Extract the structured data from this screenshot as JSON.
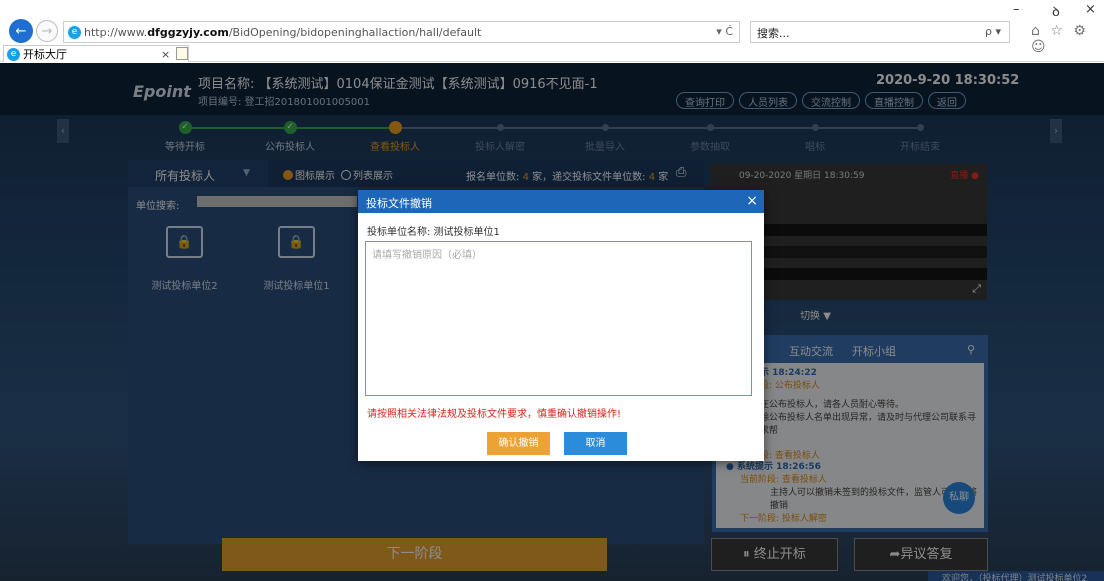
{
  "browser": {
    "url_prefix": "http://www.",
    "url_domain": "dfggzyjy.com",
    "url_path": "/BidOpening/bidopeninghallaction/hall/default",
    "addr_tail": "▾ Ċ",
    "search_text": "搜索...",
    "search_icon": "ρ ▾",
    "tab_title": "开标大厅",
    "tab_close": "×",
    "win_min": "–",
    "win_max": "ꝺ",
    "win_close": "×",
    "toolbar_icons": "⌂ ☆ ⚙ ☺"
  },
  "header": {
    "logo": "Epoint",
    "project_name": "项目名称: 【系统测试】0104保证金测试【系统测试】0916不见面-1",
    "project_no": "项目编号: 登工招201801001005001",
    "datetime": "2020-9-20  18:30:52",
    "buttons": [
      "查询打印",
      "人员列表",
      "交流控制",
      "直播控制",
      "返回"
    ]
  },
  "steps": [
    {
      "label": "等待开标",
      "state": "done"
    },
    {
      "label": "公布投标人",
      "state": "done"
    },
    {
      "label": "查看投标人",
      "state": "current"
    },
    {
      "label": "投标人解密",
      "state": "todo"
    },
    {
      "label": "批量导入",
      "state": "todo"
    },
    {
      "label": "参数抽取",
      "state": "todo"
    },
    {
      "label": "唱标",
      "state": "todo"
    },
    {
      "label": "开标结束",
      "state": "todo"
    }
  ],
  "panel": {
    "title": "所有投标人",
    "title_caret": "▼",
    "radio_icon": "图标展示",
    "radio_list": "列表展示",
    "count_a_label": "报名单位数:",
    "count_a": "4",
    "count_b_label": "家，递交投标文件单位数:",
    "count_b": "4",
    "count_unit": "家",
    "print_icon": "⎙",
    "search_label": "单位搜索:",
    "units": [
      "测试投标单位2",
      "测试投标单位1"
    ]
  },
  "video": {
    "timestamp": "09-20-2020 星期日 18:30:59",
    "switch_label": "切换 ▼",
    "rec": "直播 ●",
    "fullscreen": "⤢"
  },
  "chat": {
    "tabs": [
      "互动交流",
      "开标小组"
    ],
    "search_icon": "⚲",
    "msg1": {
      "time": "示 18:24:22",
      "stage": "段: 公布投标人",
      "body1": "在公布投标人，请各人员耐心等待。",
      "body2": "除公布投标人名单出现异常，请及时与代理公司联系寻求帮",
      "next": "段: 查看投标人"
    },
    "msg2": {
      "title": "系统提示 18:26:56",
      "stage": "当前阶段: 查看投标人",
      "body": "主持人可以撤销未签到的投标文件，监管人可以即将撤销",
      "next": "下一阶段: 投标人解密"
    },
    "sixin": "私聊"
  },
  "footer": {
    "next_stage": "下一阶段",
    "stop": "⏸ 终止开标",
    "objection": "➦异议答复",
    "welcome": "欢迎您，（投标代理）测试投标单位2"
  },
  "modal": {
    "title": "投标文件撤销",
    "close": "×",
    "unit_label": "投标单位名称: 测试投标单位1",
    "placeholder": "请填写撤销原因（必填）",
    "warning": "请按照相关法律法规及投标文件要求，慎重确认撤销操作!",
    "confirm": "确认撤销",
    "cancel": "取消"
  }
}
